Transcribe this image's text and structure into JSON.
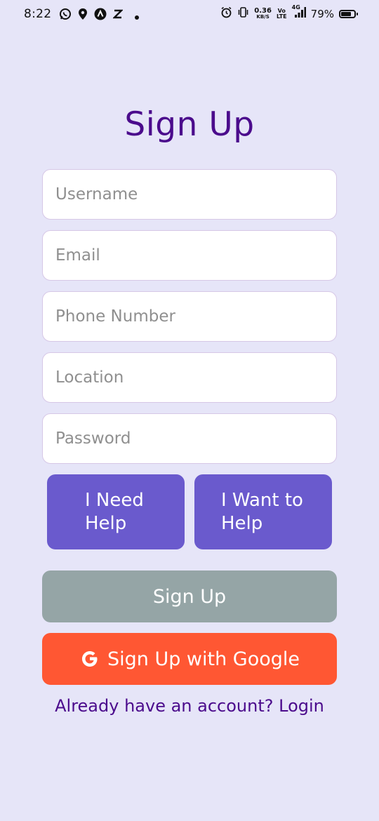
{
  "status_bar": {
    "time": "8:22",
    "net_speed_value": "0.36",
    "net_speed_unit": "KB/S",
    "volte_top": "Vo",
    "volte_bottom": "LTE",
    "network_type": "4G",
    "battery_percent": "79%",
    "battery_level": 0.79
  },
  "form": {
    "title": "Sign Up",
    "fields": {
      "username": {
        "placeholder": "Username",
        "value": ""
      },
      "email": {
        "placeholder": "Email",
        "value": ""
      },
      "phone": {
        "placeholder": "Phone Number",
        "value": ""
      },
      "location": {
        "placeholder": "Location",
        "value": ""
      },
      "password": {
        "placeholder": "Password",
        "value": ""
      }
    },
    "role_need_help_label": "I Need\nHelp",
    "role_want_help_label": "I Want to\nHelp",
    "signup_button_label": "Sign Up",
    "google_button_label": "Sign Up with Google",
    "login_link_text": "Already have an account? Login"
  },
  "colors": {
    "background": "#e6e5f8",
    "title": "#4b0b8c",
    "role_button": "#6a5acd",
    "signup_button": "#95a5a6",
    "google_button": "#ff5733"
  },
  "icons": [
    "whatsapp-icon",
    "location-pin-icon",
    "app-a-icon",
    "app-z-icon",
    "notification-dot-icon",
    "alarm-icon",
    "vibrate-icon",
    "signal-icon",
    "battery-icon",
    "google-icon"
  ]
}
